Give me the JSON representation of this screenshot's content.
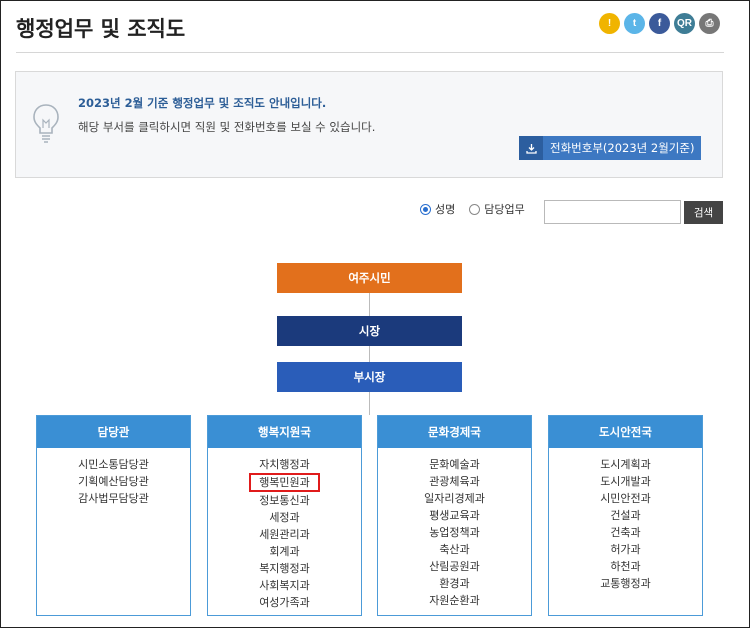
{
  "page": {
    "title": "행정업무 및 조직도"
  },
  "share": [
    {
      "name": "kakaostory-share-button",
      "glyph": "!",
      "color": "#f0b400"
    },
    {
      "name": "twitter-share-button",
      "glyph": "t",
      "color": "#5bb5e8"
    },
    {
      "name": "facebook-share-button",
      "glyph": "f",
      "color": "#3b5a9a"
    },
    {
      "name": "qr-code-button",
      "glyph": "QR",
      "color": "#3e7d96"
    },
    {
      "name": "print-button",
      "glyph": "⎙",
      "color": "#777777"
    }
  ],
  "info": {
    "title": "2023년 2월 기준 행정업무 및 조직도 안내입니다.",
    "desc": "해당 부서를 클릭하시면 직원 및 전화번호를 보실 수 있습니다.",
    "phone_book": "전화번호부(2023년 2월기준)"
  },
  "search": {
    "option_name": "성명",
    "option_task": "담당업무",
    "value": "",
    "button": "검색"
  },
  "org": {
    "citizen": "여주시민",
    "mayor": "시장",
    "vice_mayor": "부시장",
    "departments": [
      {
        "name": "담당관",
        "items": [
          "시민소통담당관",
          "기획예산담당관",
          "감사법무담당관"
        ]
      },
      {
        "name": "행복지원국",
        "items": [
          "자치행정과",
          "행복민원과",
          "정보통신과",
          "세정과",
          "세원관리과",
          "회계과",
          "복지행정과",
          "사회복지과",
          "여성가족과"
        ],
        "highlight": 1
      },
      {
        "name": "문화경제국",
        "items": [
          "문화예술과",
          "관광체육과",
          "일자리경제과",
          "평생교육과",
          "농업정책과",
          "축산과",
          "산림공원과",
          "환경과",
          "자원순환과"
        ]
      },
      {
        "name": "도시안전국",
        "items": [
          "도시계획과",
          "도시개발과",
          "시민안전과",
          "건설과",
          "건축과",
          "허가과",
          "하천과",
          "교통행정과"
        ]
      }
    ]
  },
  "colors": {
    "citizen": "#e2701c",
    "mayor": "#1b3a7c",
    "vice_mayor": "#2a5db9",
    "dept_head": "#3a8fd4",
    "highlight": "#e01b1b"
  }
}
